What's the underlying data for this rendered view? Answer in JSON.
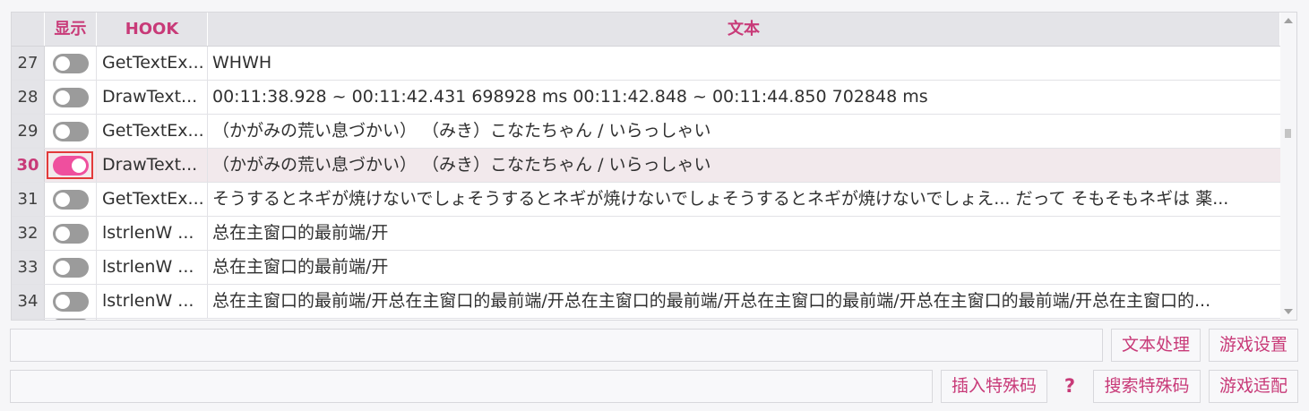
{
  "table": {
    "headers": {
      "show": "显示",
      "hook": "HOOK",
      "text": "文本"
    },
    "rows": [
      {
        "num": "27",
        "on": false,
        "hook": "GetTextEx...",
        "text": "WHWH"
      },
      {
        "num": "28",
        "on": false,
        "hook": "DrawText...",
        "text": " 00:11:38.928 ~ 00:11:42.431 698928 ms 00:11:42.848 ~ 00:11:44.850 702848 ms"
      },
      {
        "num": "29",
        "on": false,
        "hook": "GetTextEx...",
        "text": "（かがみの荒い息づかい） （みき）こなたちゃん / いらっしゃい"
      },
      {
        "num": "30",
        "on": true,
        "hook": "DrawText...",
        "text": "（かがみの荒い息づかい） （みき）こなたちゃん / いらっしゃい"
      },
      {
        "num": "31",
        "on": false,
        "hook": "GetTextEx...",
        "text": "そうするとネギが焼けないでしょそうするとネギが焼けないでしょそうするとネギが焼けないでしょえ... だって そもそもネギは 薬..."
      },
      {
        "num": "32",
        "on": false,
        "hook": "lstrlenW ...",
        "text": "总在主窗口的最前端/开"
      },
      {
        "num": "33",
        "on": false,
        "hook": "lstrlenW ...",
        "text": "总在主窗口的最前端/开"
      },
      {
        "num": "34",
        "on": false,
        "hook": "lstrlenW ...",
        "text": "总在主窗口的最前端/开总在主窗口的最前端/开总在主窗口的最前端/开总在主窗口的最前端/开总在主窗口的最前端/开总在主窗口的..."
      }
    ]
  },
  "buttons": {
    "text_processing": "文本处理",
    "game_settings": "游戏设置",
    "insert_special_code": "插入特殊码",
    "help": "?",
    "search_special_code": "搜索特殊码",
    "game_adapt": "游戏适配"
  },
  "colors": {
    "accent": "#c83a78",
    "toggle_on": "#ef4f9e",
    "toggle_off": "#9b9b9b",
    "selected_row": "#f2e9ec",
    "focus_ring": "#e23a3a"
  }
}
